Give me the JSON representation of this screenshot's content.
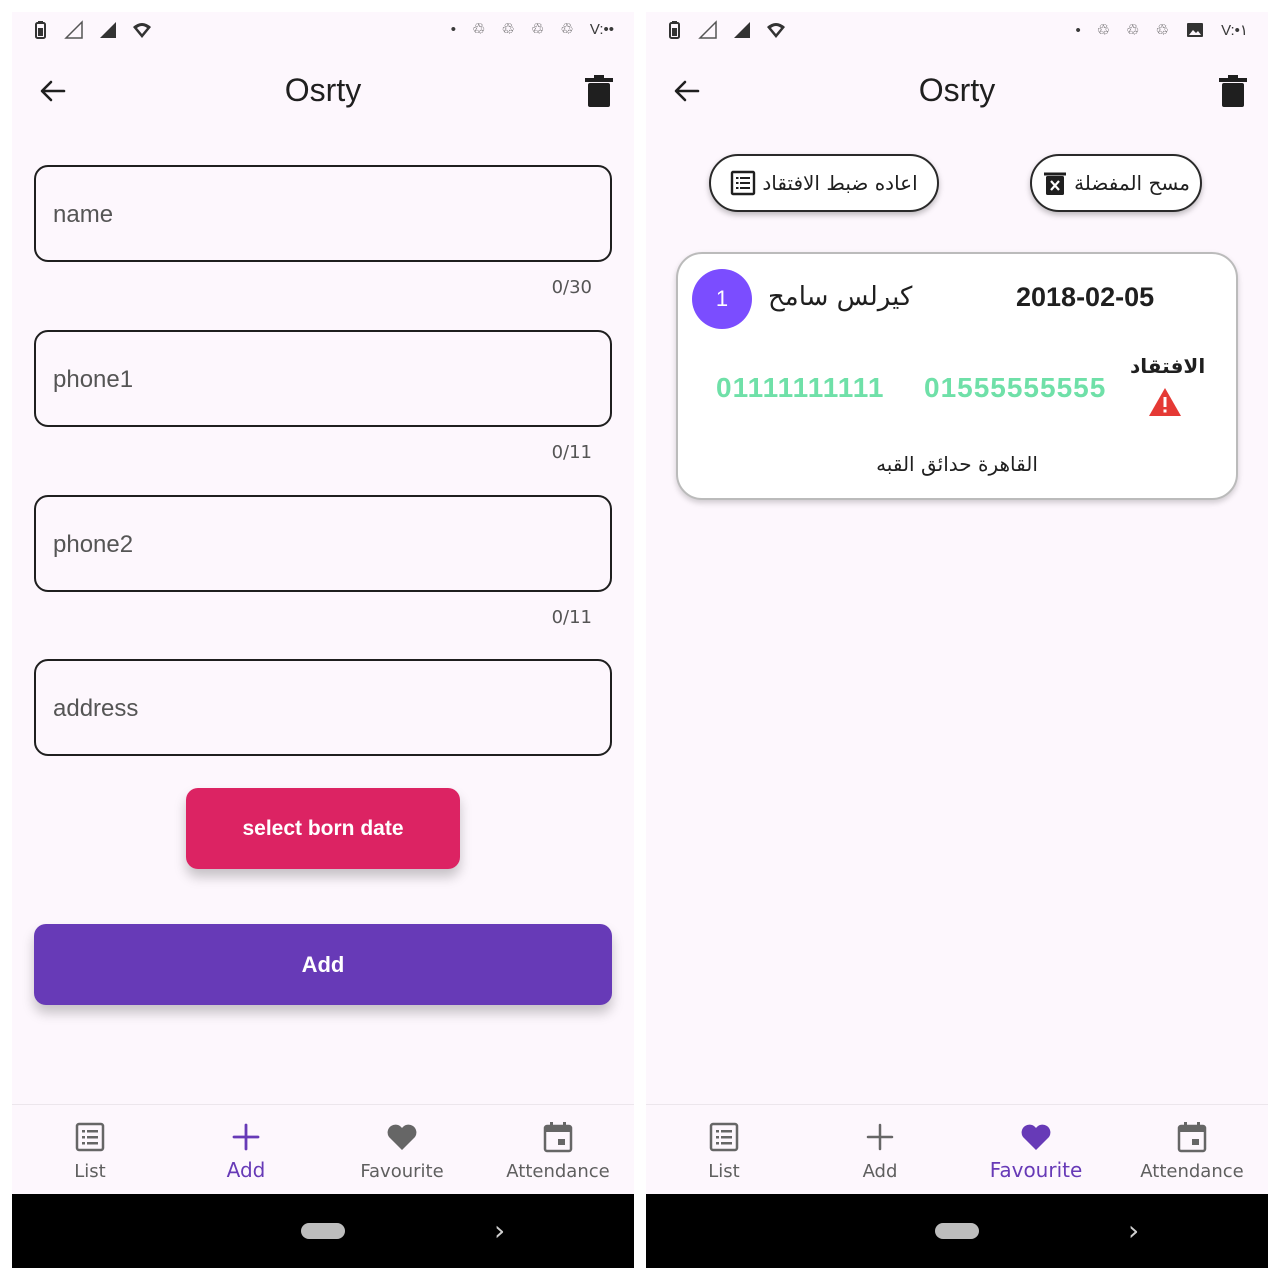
{
  "status_bar": {
    "time_left": "V:••",
    "time_right": "V:•۱"
  },
  "app": {
    "title": "Osrty"
  },
  "form": {
    "name": {
      "placeholder": "name",
      "counter": "0/30"
    },
    "phone1": {
      "placeholder": "phone1",
      "counter": "0/11"
    },
    "phone2": {
      "placeholder": "phone2",
      "counter": "0/11"
    },
    "address": {
      "placeholder": "address"
    },
    "select_date_label": "select born date",
    "add_label": "Add"
  },
  "favourites": {
    "reset_absence_label": "اعاده ضبط الافتقاد",
    "clear_favourite_label": "مسح المفضلة",
    "card": {
      "index": "1",
      "name": "كيرلس سامح",
      "born_date": "2018-02-05",
      "phone1": "01111111111",
      "phone2": "01555555555",
      "absence_label": "الافتقاد",
      "address": "القاهرة حدائق القبه"
    }
  },
  "bottom_nav": [
    {
      "label": "List",
      "icon": "list-icon"
    },
    {
      "label": "Add",
      "icon": "plus-icon"
    },
    {
      "label": "Favourite",
      "icon": "heart-icon"
    },
    {
      "label": "Attendance",
      "icon": "calendar-icon"
    }
  ],
  "colors": {
    "primary": "#673ab7",
    "pink": "#dc2363",
    "phone_green": "#6fe0a8",
    "avatar": "#7b4dff",
    "warning": "#e53935",
    "background": "#fdf7fd"
  }
}
